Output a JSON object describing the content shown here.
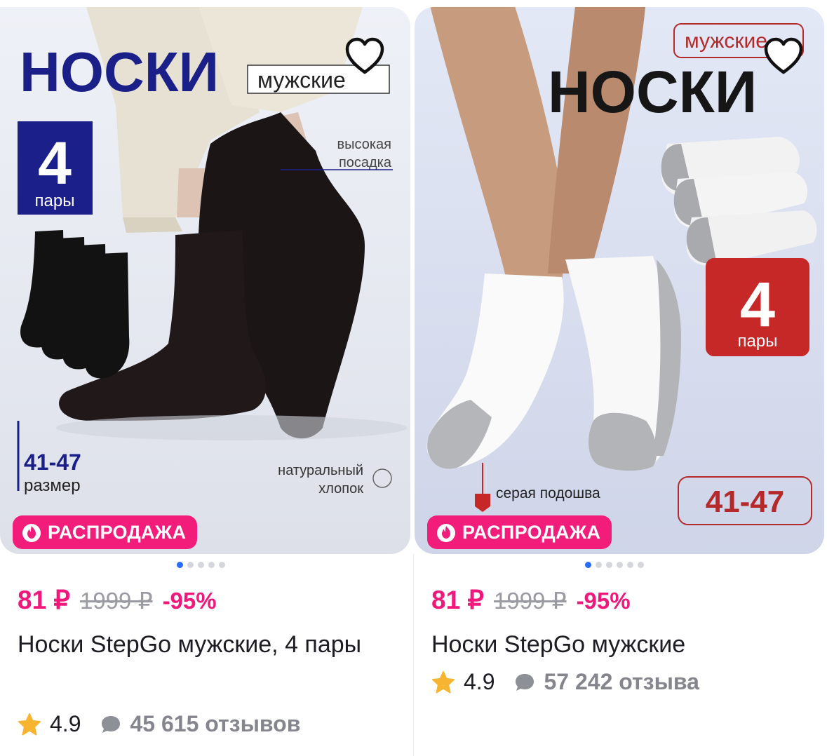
{
  "products": [
    {
      "image_texts": {
        "headline": "НОСКИ",
        "tag": "мужские",
        "pairs_number": "4",
        "pairs_label": "пары",
        "fit": "высокая\nпосадка",
        "size": "41-47",
        "size_label": "размер",
        "cotton": "натуральный\nхлопок"
      },
      "sale_label": "РАСПРОДАЖА",
      "carousel": {
        "total": 5,
        "active": 0
      },
      "price": "81 ₽",
      "old_price": "1999 ₽",
      "discount": "-95%",
      "title": "Носки StepGo мужские, 4 пары",
      "rating": "4.9",
      "reviews": "45 615 отзывов"
    },
    {
      "image_texts": {
        "tag": "мужские",
        "headline": "НОСКИ",
        "pairs_number": "4",
        "pairs_label": "пары",
        "sole": "серая подошва",
        "size": "41-47"
      },
      "sale_label": "РАСПРОДАЖА",
      "carousel": {
        "total": 6,
        "active": 0
      },
      "price": "81 ₽",
      "old_price": "1999 ₽",
      "discount": "-95%",
      "title": "Носки StepGo мужские",
      "rating": "4.9",
      "reviews": "57 242 отзыва"
    }
  ],
  "colors": {
    "sale_badge": "#f21d7a",
    "price": "#f0187a",
    "dot_active": "#2a6bff",
    "star": "#f6b431"
  },
  "icons": [
    "heart-outline-icon",
    "fire-icon",
    "star-icon",
    "chat-bubble-icon"
  ]
}
